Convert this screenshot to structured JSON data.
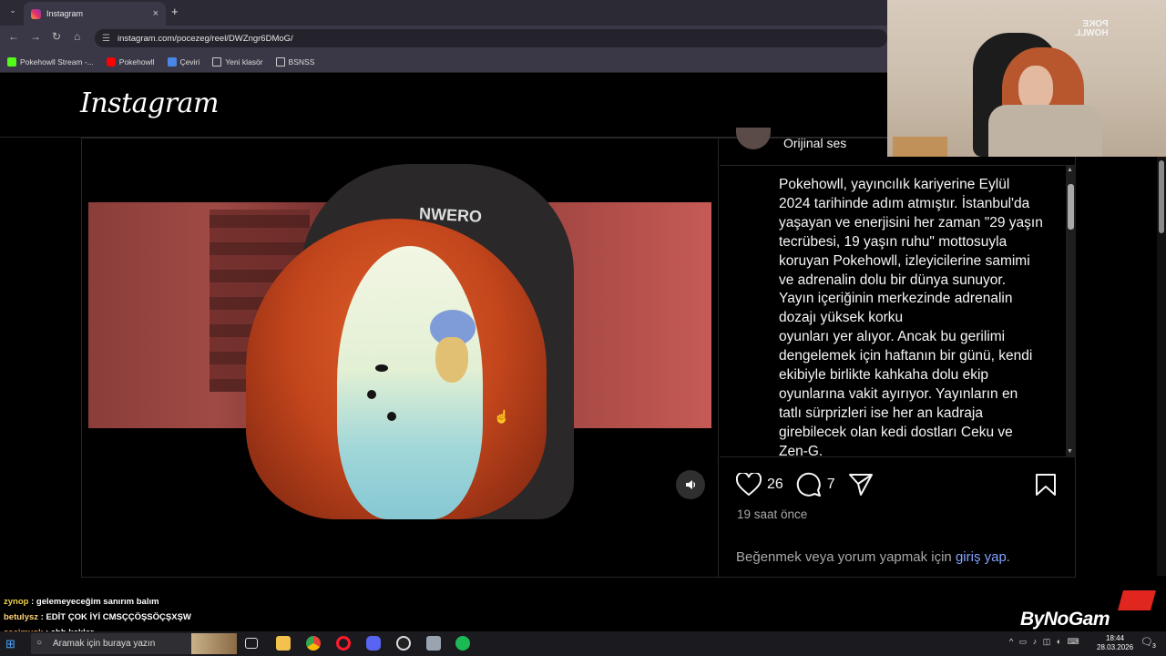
{
  "browser": {
    "tab_title": "Instagram",
    "url": "instagram.com/pocezeg/reel/DWZngr6DMoG/",
    "bookmarks": [
      {
        "label": "Pokehowll Stream -...",
        "icon": "kick-icon"
      },
      {
        "label": "Pokehowll",
        "icon": "youtube-icon"
      },
      {
        "label": "Çeviri",
        "icon": "translate-icon"
      },
      {
        "label": "Yeni klasör",
        "icon": "folder-icon"
      },
      {
        "label": "BSNSS",
        "icon": "folder-icon"
      }
    ]
  },
  "instagram": {
    "logo": "Instagram",
    "video": {
      "chair_text": "NWERO"
    },
    "post": {
      "audio_label": "Orijinal ses",
      "caption": "Pokehowll, yayıncılık kariyerine Eylül\n2024 tarihinde adım atmıştır. İstanbul'da\nyaşayan ve enerjisini her zaman \"29 yaşın\ntecrübesi, 19 yaşın ruhu\" mottosuyla\nkoruyan Pokehowll, izleyicilerine samimi\nve adrenalin dolu bir dünya sunuyor.\nYayın içeriğinin merkezinde adrenalin\ndozajı yüksek korku\noyunları yer alıyor. Ancak bu gerilimi\ndengelemek için haftanın bir günü, kendi\nekibiyle birlikte kahkaha dolu ekip\noyunlarına vakit ayırıyor. Yayınların en\ntatlı sürprizleri ise her an kadraja\ngirebilecek olan kedi dostları Ceku ve\nZen-G.",
      "likes": "26",
      "comments": "7",
      "time_ago": "19 saat önce",
      "login_prefix": "Beğenmek veya yorum yapmak için ",
      "login_link": "giriş yap",
      "login_suffix": "."
    }
  },
  "stream_overlay": {
    "cam_logo": "POKE\nHOWLL",
    "chat": [
      {
        "user": "zynop",
        "message": "gelemeyeceğim sanırım balım"
      },
      {
        "user": "betulysz",
        "message": "EDİT ÇOK İYİ CMSÇÇÖŞSÖÇŞXŞW"
      },
      {
        "user": "sacimyok",
        "message": "ahh kekler"
      }
    ],
    "brand": "ByNoGam"
  },
  "taskbar": {
    "search_placeholder": "Aramak için buraya yazın",
    "time": "18:44",
    "date": "28.03.2026",
    "notification_count": "3",
    "apps": [
      "task-view-icon",
      "file-explorer-icon",
      "chrome-icon",
      "opera-icon",
      "discord-icon",
      "obs-icon",
      "app-icon",
      "spotify-icon"
    ]
  }
}
